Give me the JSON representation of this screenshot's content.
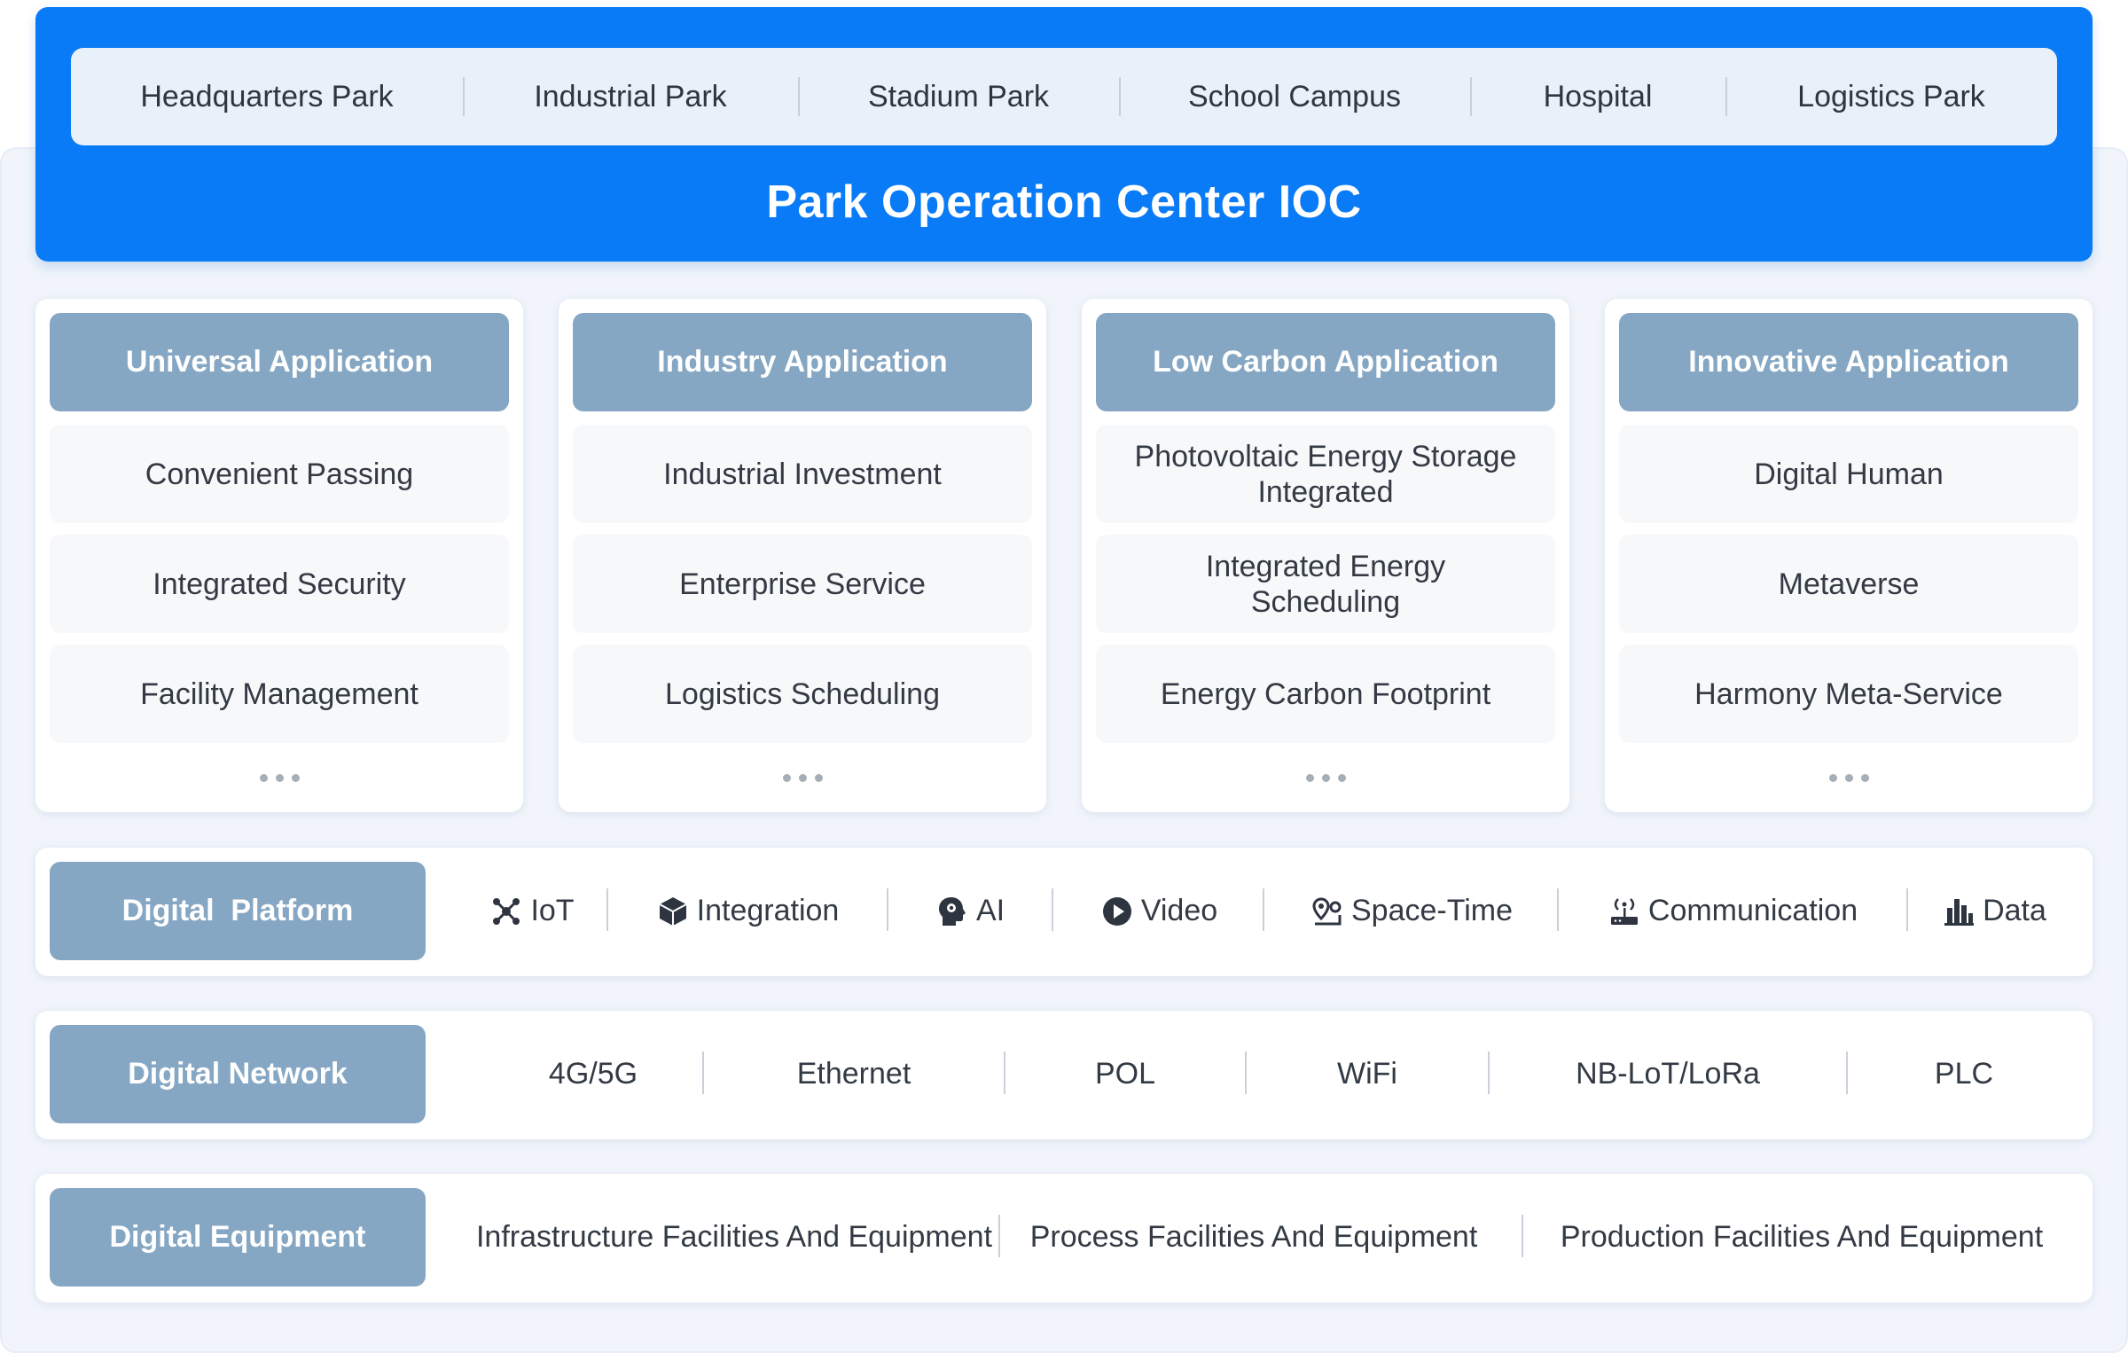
{
  "parks": [
    "Headquarters Park",
    "Industrial Park",
    "Stadium Park",
    "School Campus",
    "Hospital",
    "Logistics Park"
  ],
  "ioc_title": "Park Operation Center IOC",
  "applications": [
    {
      "title": "Universal Application",
      "items": [
        "Convenient Passing",
        "Integrated Security",
        "Facility Management"
      ]
    },
    {
      "title": "Industry Application",
      "items": [
        "Industrial Investment",
        "Enterprise Service",
        "Logistics Scheduling"
      ]
    },
    {
      "title": "Low Carbon Application",
      "items": [
        "Photovoltaic Energy Storage Integrated",
        "Integrated Energy Scheduling",
        "Energy Carbon Footprint"
      ]
    },
    {
      "title": "Innovative Application",
      "items": [
        "Digital Human",
        "Metaverse",
        "Harmony Meta-Service"
      ]
    }
  ],
  "more_indicator": "more-dots",
  "platform": {
    "title": "Digital  Platform",
    "items": [
      {
        "label": "IoT",
        "icon": "iot-icon"
      },
      {
        "label": "Integration",
        "icon": "cube-icon"
      },
      {
        "label": "AI",
        "icon": "ai-head-icon"
      },
      {
        "label": "Video",
        "icon": "play-icon"
      },
      {
        "label": "Space-Time",
        "icon": "location-icon"
      },
      {
        "label": "Communication",
        "icon": "router-icon"
      },
      {
        "label": "Data",
        "icon": "bar-chart-icon"
      }
    ]
  },
  "network": {
    "title": "Digital Network",
    "items": [
      "4G/5G",
      "Ethernet",
      "POL",
      "WiFi",
      "NB-LoT/LoRa",
      "PLC"
    ]
  },
  "equipment": {
    "title": "Digital Equipment",
    "items": [
      "Infrastructure Facilities And Equipment",
      "Process Facilities And Equipment",
      "Production Facilities And Equipment"
    ]
  },
  "colors": {
    "ioc_blue": "#0a7bf7",
    "header_steel": "#85a7c3",
    "park_bar": "#e8f0fa",
    "background": "#f1f5fb"
  }
}
